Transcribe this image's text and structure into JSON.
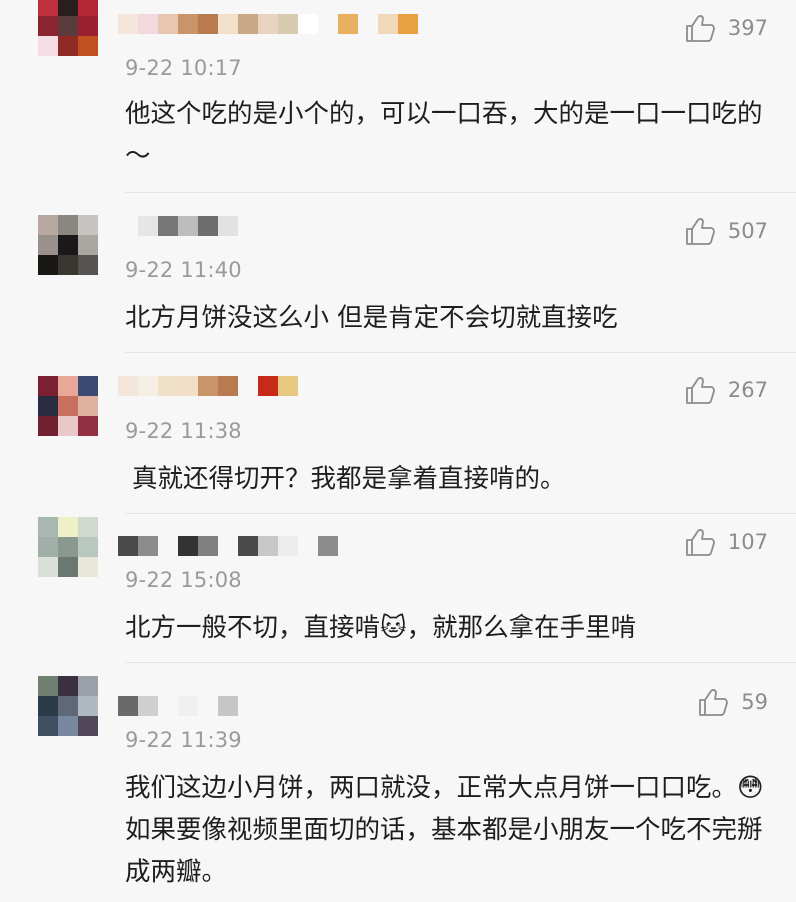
{
  "comments": [
    {
      "time": "9-22 10:17",
      "likes": "397",
      "text": "他这个吃的是小个的，可以一口吞，大的是一口一口吃的～",
      "avatar_colors": [
        "#c0313f",
        "#2a1d1d",
        "#b42535",
        "#8a2430",
        "#5a3a3a",
        "#9a2030",
        "#f5dde6",
        "#8f2a24",
        "#c05020"
      ],
      "name_colors": [
        "#f5e6dc",
        "#f3d9df",
        "#e8c7b0",
        "#c9946a",
        "#b97a50",
        "#f2e0c8",
        "#c9a888",
        "#e7d3c0",
        "#d8ccb0",
        "#ffffff",
        "#f7f7f7",
        "#e8b060",
        "#f7f7f7",
        "#f0d8b8",
        "#e8a040"
      ]
    },
    {
      "time": "9-22 11:40",
      "likes": "507",
      "text": "北方月饼没这么小 但是肯定不会切就直接吃",
      "avatar_colors": [
        "#b8a8a0",
        "#8a8680",
        "#c6c4c0",
        "#9a908c",
        "#1a1818",
        "#a8a8a0",
        "#1a1814",
        "#3a3632",
        "#565450"
      ],
      "name_colors": [
        "#f7f7f7",
        "#e6e6e6",
        "#777777",
        "#bdbdbd",
        "#6d6d6d",
        "#e2e2e2"
      ]
    },
    {
      "time": "9-22 11:38",
      "likes": "267",
      "text": "真就还得切开？我都是拿着直接啃的。",
      "avatar_colors": [
        "#7a2030",
        "#e8a898",
        "#3a4a70",
        "#2a2a40",
        "#c87060",
        "#e0b0a0",
        "#702030",
        "#e8c8c8",
        "#903040"
      ],
      "name_colors": [
        "#f5e6dc",
        "#f5eee4",
        "#f0e0c8",
        "#f3dfc8",
        "#c9946a",
        "#b97a50",
        "#f7f7f7",
        "#c82a1a",
        "#e8c880"
      ]
    },
    {
      "time": "9-22 15:08",
      "likes": "107",
      "text": "北方一般不切，直接啃🐱，就那么拿在手里啃",
      "avatar_colors": [
        "#a8b8b0",
        "#f0f0c8",
        "#d0d8d0",
        "#a0b0a8",
        "#8a9890",
        "#b8c8c0",
        "#d8e0d8",
        "#6a7870",
        "#e8e8d8"
      ],
      "name_colors": [
        "#4a4a4a",
        "#8c8c8c",
        "#f7f7f7",
        "#333333",
        "#808080",
        "#f7f7f7",
        "#4a4a4a",
        "#c8c8c8",
        "#ededed",
        "#f7f7f7",
        "#8c8c8c"
      ]
    },
    {
      "time": "9-22 11:39",
      "likes": "59",
      "text": "我们这边小月饼，两口就没，正常大点月饼一口口吃。😳如果要像视频里面切的话，基本都是小朋友一个吃不完掰成两瓣。",
      "avatar_colors": [
        "#708070",
        "#3a3040",
        "#9aa0a8",
        "#2a3a48",
        "#606878",
        "#b0b8c0",
        "#405060",
        "#7888a0",
        "#504858"
      ],
      "name_colors": [
        "#6a6a6a",
        "#cfcfcf",
        "#f7f7f7",
        "#f0f0f0",
        "#f7f7f7",
        "#c6c6c6"
      ]
    }
  ]
}
